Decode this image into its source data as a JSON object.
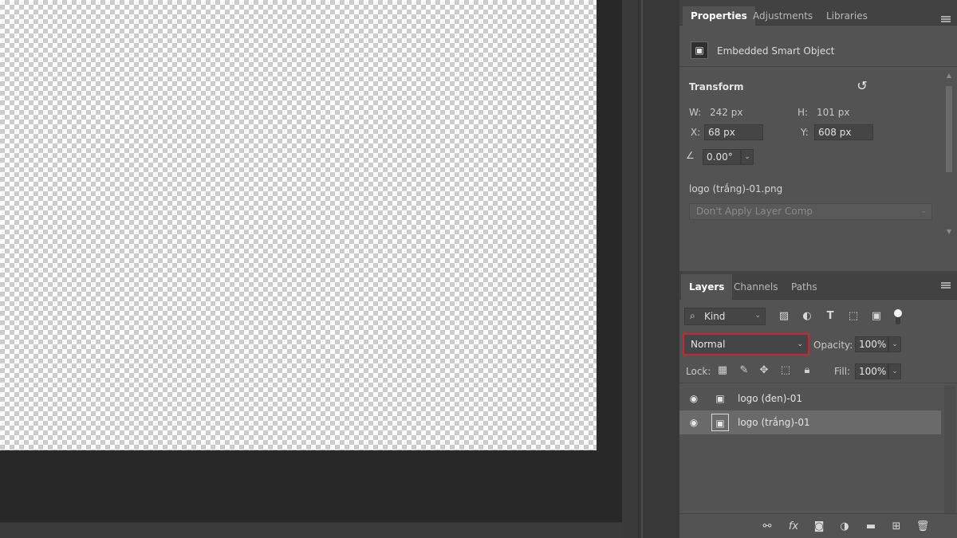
{
  "properties": {
    "tabs": [
      "Properties",
      "Adjustments",
      "Libraries"
    ],
    "object_type": "Embedded Smart Object",
    "transform_title": "Transform",
    "w_label": "W:",
    "w_value": "242 px",
    "h_label": "H:",
    "h_value": "101 px",
    "x_label": "X:",
    "x_value": "68 px",
    "y_label": "Y:",
    "y_value": "608 px",
    "angle_value": "0.00°",
    "filename": "logo (trắng)-01.png",
    "layer_comp": "Don't Apply Layer Comp"
  },
  "layers": {
    "tabs": [
      "Layers",
      "Channels",
      "Paths"
    ],
    "filter_kind": "Kind",
    "blend_mode": "Normal",
    "opacity_label": "Opacity:",
    "opacity_value": "100%",
    "lock_label": "Lock:",
    "fill_label": "Fill:",
    "fill_value": "100%",
    "items": [
      {
        "name": "logo (đen)-01",
        "selected": false
      },
      {
        "name": "logo (trắng)-01",
        "selected": true
      }
    ],
    "bottom_icons": [
      "link-layers-icon",
      "fx-icon",
      "add-mask-icon",
      "adjustment-layer-icon",
      "new-group-icon",
      "new-layer-icon",
      "delete-layer-icon"
    ]
  },
  "colors": {
    "panel_bg": "#535353",
    "tab_bar_bg": "#424242",
    "highlight_border": "#c8243a",
    "selected_layer_bg": "#6a6a6a"
  }
}
